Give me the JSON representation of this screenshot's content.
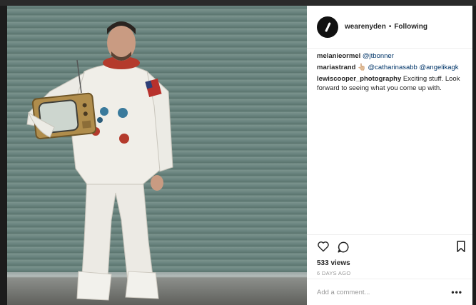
{
  "post": {
    "username": "wearenyden",
    "separator": "•",
    "follow_status": "Following",
    "comments": [
      {
        "user": "melanieormel",
        "text": "",
        "mentions": [
          "@jtbonner"
        ]
      },
      {
        "user": "mariastrand",
        "text": "👆🏼",
        "mentions": [
          "@catharinasabb",
          "@angelikagk"
        ]
      },
      {
        "user": "lewiscooper_photography",
        "text": "Exciting stuff. Look forward to seeing what you come up with.",
        "mentions": []
      }
    ],
    "views": "533 views",
    "posted": "6 DAYS AGO",
    "comment_placeholder": "Add a comment...",
    "more_label": "•••"
  },
  "icons": {
    "like": "heart-icon",
    "comment": "speech-bubble-icon",
    "save": "bookmark-icon",
    "avatar": "nyden-logo-avatar"
  },
  "colors": {
    "mention": "#003569",
    "text": "#262626",
    "muted": "#999999",
    "wall": "#6b8580"
  }
}
